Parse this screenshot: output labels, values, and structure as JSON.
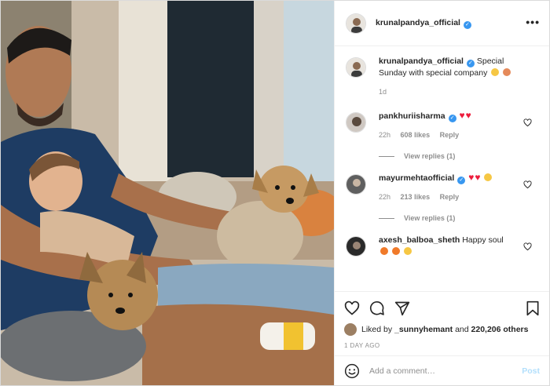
{
  "photo": {
    "alt": "Photo by krunalpandya_official"
  },
  "header": {
    "username": "krunalpandya_official",
    "verified_mark": "✓",
    "more_label": "•••"
  },
  "caption": {
    "username": "krunalpandya_official",
    "text": "Special Sunday with special company",
    "age": "1d"
  },
  "comments": [
    {
      "username": "pankhuriisharma",
      "verified": true,
      "text": "",
      "age": "22h",
      "likes": "608 likes",
      "reply": "Reply",
      "view_replies": "View replies (1)"
    },
    {
      "username": "mayurmehtaofficial",
      "verified": true,
      "text": "",
      "age": "22h",
      "likes": "213 likes",
      "reply": "Reply",
      "view_replies": "View replies (1)"
    },
    {
      "username": "axesh_balboa_sheth",
      "verified": false,
      "text": "Happy soul"
    }
  ],
  "likes": {
    "prefix": "Liked by ",
    "user": "_sunnyhemant",
    "middle": " and ",
    "count": "220,206 others"
  },
  "post_age": "1 DAY AGO",
  "add_comment": {
    "placeholder": "Add a comment…",
    "post_label": "Post"
  },
  "colors": {
    "verified": "#3897f0",
    "heart": "#ed1c3c",
    "muted": "#8e8e8e",
    "post_button": "#b2dffc"
  },
  "icons": [
    "heart-icon",
    "comment-icon",
    "share-icon",
    "bookmark-icon",
    "smiley-icon",
    "more-icon"
  ]
}
